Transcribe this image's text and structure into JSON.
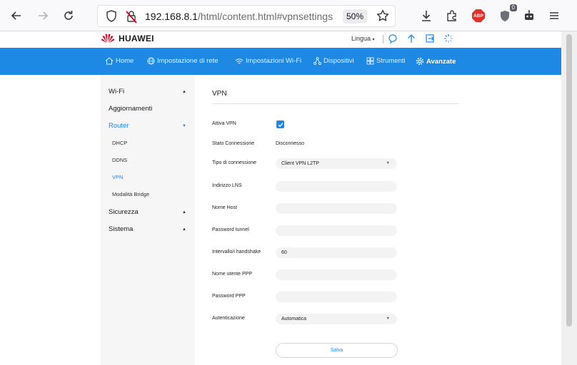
{
  "browser": {
    "url_host": "192.168.8.1",
    "url_path": "/html/content.html#vpnsettings",
    "zoom": "50%",
    "abp_label": "ABP",
    "extension_badge": "0",
    "icons": [
      "back-icon",
      "forward-icon",
      "reload-icon",
      "shield-icon",
      "insecure-lock-icon",
      "star-icon",
      "download-icon",
      "extensions-icon",
      "abp-icon",
      "privacy-badger-icon",
      "robot-icon",
      "menu-icon"
    ]
  },
  "header": {
    "brand": "HUAWEI",
    "language": "Lingua"
  },
  "nav": {
    "items": [
      {
        "label": "Home",
        "icon": "home-icon"
      },
      {
        "label": "Impostazione di rete",
        "icon": "globe-icon"
      },
      {
        "label": "Impostazioni Wi-Fi",
        "icon": "wifi-icon"
      },
      {
        "label": "Dispositivi",
        "icon": "devices-icon"
      },
      {
        "label": "Strumenti",
        "icon": "tools-icon"
      },
      {
        "label": "Avanzate",
        "icon": "gear-icon",
        "active": true
      }
    ]
  },
  "sidebar": {
    "items": [
      {
        "label": "Wi-Fi"
      },
      {
        "label": "Aggiornamenti"
      },
      {
        "label": "Router",
        "active": true
      },
      {
        "label": "DHCP"
      },
      {
        "label": "DDNS"
      },
      {
        "label": "VPN",
        "active": true
      },
      {
        "label": "Modalità Bridge"
      },
      {
        "label": "Sicurezza"
      },
      {
        "label": "Sistema"
      }
    ]
  },
  "vpn": {
    "title": "VPN",
    "enable_label": "Attiva VPN",
    "enabled": true,
    "status_label": "Stato Connessione",
    "status_value": "Disconnesso",
    "type_label": "Tipo di connessione",
    "type_value": "Client VPN L2TP",
    "lns_label": "Indirizzo LNS",
    "lns_value": "",
    "host_label": "Nome Host",
    "host_value": "",
    "tunnel_pw_label": "Password tunnel",
    "tunnel_pw_value": "",
    "handshake_label": "Intervallo/i handshake",
    "handshake_value": "60",
    "ppp_user_label": "Nome utente PPP",
    "ppp_user_value": "",
    "ppp_pw_label": "Password PPP",
    "ppp_pw_value": "",
    "auth_label": "Autenticazione",
    "auth_value": "Automatica",
    "save_label": "Salva"
  },
  "colors": {
    "accent": "#1e88e5",
    "sidebar_bg": "#f6f6f6",
    "field_bg": "#f3f3f3",
    "huawei_red": "#cf0a2c"
  }
}
